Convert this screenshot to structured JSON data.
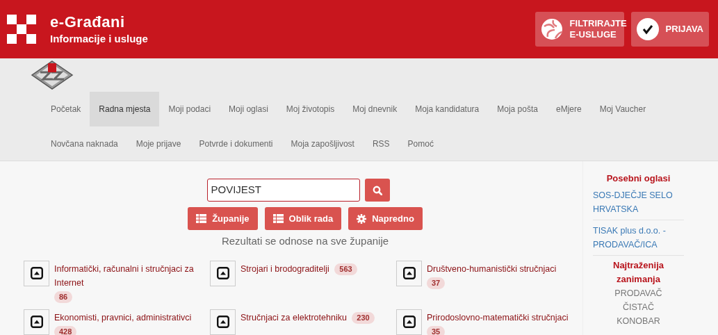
{
  "header": {
    "title": "e-Građani",
    "subtitle": "Informacije i usluge",
    "buttons": [
      {
        "kind": "filter",
        "label": "FILTRIRAJTE E-USLUGE"
      },
      {
        "kind": "login",
        "label": "PRIJAVA"
      }
    ]
  },
  "nav": {
    "items": [
      {
        "label": "Početak",
        "selected": false
      },
      {
        "label": "Radna mjesta",
        "selected": true
      },
      {
        "label": "Moji podaci",
        "selected": false
      },
      {
        "label": "Moji oglasi",
        "selected": false
      },
      {
        "label": "Moj životopis",
        "selected": false
      },
      {
        "label": "Moj dnevnik",
        "selected": false
      },
      {
        "label": "Moja kandidatura",
        "selected": false
      },
      {
        "label": "Moja pošta",
        "selected": false
      },
      {
        "label": "eMjere",
        "selected": false
      },
      {
        "label": "Moj Vaucher",
        "selected": false
      },
      {
        "label": "Novčana naknada",
        "selected": false
      },
      {
        "label": "Moje prijave",
        "selected": false
      },
      {
        "label": "Potvrde i dokumenti",
        "selected": false
      },
      {
        "label": "Moja zapošljivost",
        "selected": false
      },
      {
        "label": "RSS",
        "selected": false
      },
      {
        "label": "Pomoć",
        "selected": false
      }
    ]
  },
  "search": {
    "value": "POVIJEST",
    "filters": [
      {
        "kind": "list",
        "label": "Županije"
      },
      {
        "kind": "list",
        "label": "Oblik rada"
      },
      {
        "kind": "gear",
        "label": "Napredno"
      }
    ],
    "note": "Rezultati se odnose na sve županije"
  },
  "categories": [
    {
      "label": "Informatički, računalni i stručnjaci za Internet",
      "count": "86"
    },
    {
      "label": "Strojari i brodograditelji",
      "count": "563"
    },
    {
      "label": "Društveno-humanistički stručnjaci",
      "count": "37"
    },
    {
      "label": "Ekonomisti, pravnici, administrativci",
      "count": "428"
    },
    {
      "label": "Stručnjaci za elektrotehniku",
      "count": "230"
    },
    {
      "label": "Prirodoslovno-matematički stručnjaci",
      "count": "35"
    }
  ],
  "sidebar": {
    "special_title": "Posebni oglasi",
    "special_ads": [
      "SOS-DJEČJE SELO HRVATSKA",
      "TISAK plus d.o.o. - PRODAVAČ/ICA"
    ],
    "popular_title": "Najtraženija zanimanja",
    "popular": [
      "PRODAVAČ",
      "ČISTAČ",
      "KONOBAR"
    ]
  }
}
